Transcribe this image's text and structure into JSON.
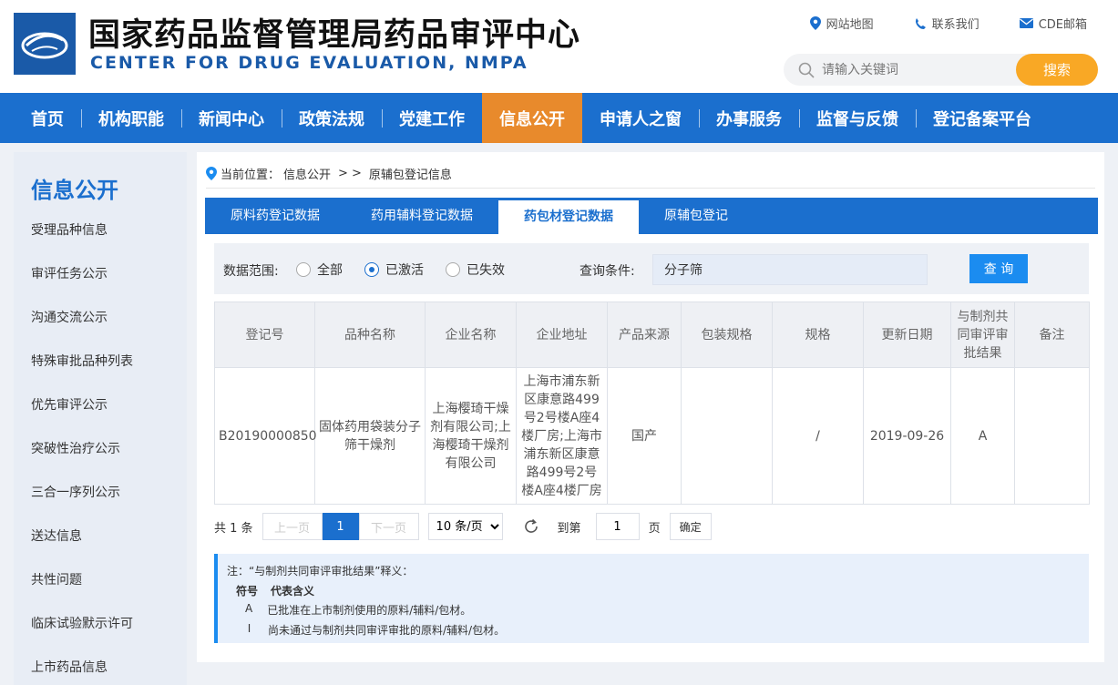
{
  "header": {
    "title_cn": "国家药品监督管理局药品审评中心",
    "title_en": "CENTER FOR DRUG EVALUATION, NMPA",
    "links": [
      {
        "label": "网站地图",
        "icon": "location-pin-icon"
      },
      {
        "label": "联系我们",
        "icon": "phone-icon"
      },
      {
        "label": "CDE邮箱",
        "icon": "mail-icon"
      }
    ],
    "search": {
      "placeholder": "请输入关键词",
      "button": "搜索"
    }
  },
  "nav": {
    "items": [
      "首页",
      "机构职能",
      "新闻中心",
      "政策法规",
      "党建工作",
      "信息公开",
      "申请人之窗",
      "办事服务",
      "监督与反馈",
      "登记备案平台"
    ],
    "active_index": 5
  },
  "sidebar": {
    "title": "信息公开",
    "items": [
      "受理品种信息",
      "审评任务公示",
      "沟通交流公示",
      "特殊审批品种列表",
      "优先审评公示",
      "突破性治疗公示",
      "三合一序列公示",
      "送达信息",
      "共性问题",
      "临床试验默示许可",
      "上市药品信息"
    ]
  },
  "breadcrumb": {
    "prefix": "当前位置：",
    "path": [
      "信息公开",
      ">",
      ">",
      "原辅包登记信息"
    ]
  },
  "tabs": [
    "原料药登记数据",
    "药用辅料登记数据",
    "药包材登记数据",
    "原辅包登记"
  ],
  "active_tab": 2,
  "filter": {
    "range_label": "数据范围:",
    "options": [
      "全部",
      "已激活",
      "已失效"
    ],
    "selected": "已激活",
    "cond_label": "查询条件:",
    "cond_value": "分子筛",
    "query_button": "查 询"
  },
  "table": {
    "headers": [
      "登记号",
      "品种名称",
      "企业名称",
      "企业地址",
      "产品来源",
      "包装规格",
      "规格",
      "更新日期",
      "与制剂共同审评审批结果",
      "备注"
    ],
    "rows": [
      [
        "B20190000850",
        "固体药用袋装分子筛干燥剂",
        "上海樱琦干燥剂有限公司;上海樱琦干燥剂有限公司",
        "上海市浦东新区康意路499号2号楼A座4楼厂房;上海市浦东新区康意路499号2号楼A座4楼厂房",
        "国产",
        "",
        "/",
        "2019-09-26",
        "A",
        ""
      ]
    ]
  },
  "pager": {
    "total": "共 1 条",
    "prev": "上一页",
    "current": "1",
    "next": "下一页",
    "page_size": "10 条/页",
    "goto_prefix": "到第",
    "goto_value": "1",
    "goto_suffix": "页",
    "confirm": "确定"
  },
  "notes": {
    "title": "注：“与制剂共同审评审批结果”释义：",
    "head_symbol": "符号",
    "head_meaning": "代表含义",
    "rows": [
      {
        "symbol": "A",
        "meaning": "已批准在上市制剂使用的原料/辅料/包材。"
      },
      {
        "symbol": "I",
        "meaning": "尚未通过与制剂共同审评审批的原料/辅料/包材。"
      }
    ]
  },
  "colors": {
    "primary": "#1b6fce",
    "nav_active": "#e88a2c",
    "search_btn": "#f9a825",
    "query_btn": "#1b8cf0"
  }
}
